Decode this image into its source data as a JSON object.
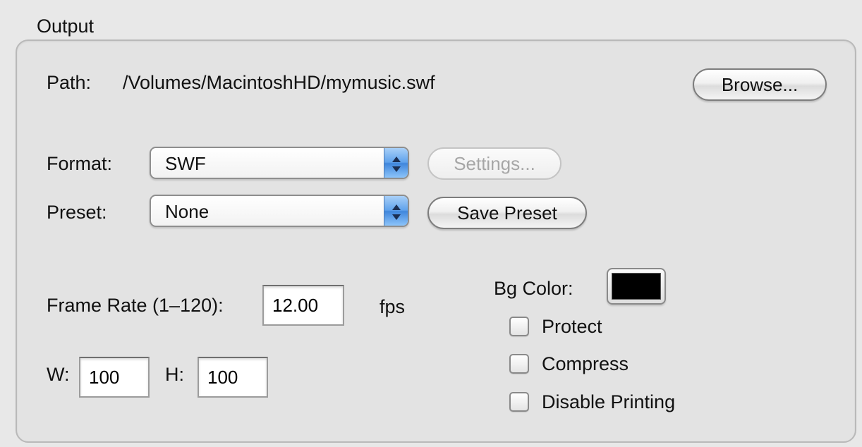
{
  "group": {
    "title": "Output"
  },
  "path": {
    "label": "Path:",
    "value": "/Volumes/MacintoshHD/mymusic.swf",
    "browse_label": "Browse..."
  },
  "format": {
    "label": "Format:",
    "selected": "SWF",
    "settings_label": "Settings...",
    "settings_enabled": false
  },
  "preset": {
    "label": "Preset:",
    "selected": "None",
    "save_label": "Save Preset"
  },
  "frame_rate": {
    "label": "Frame Rate (1–120):",
    "value": "12.00",
    "unit": "fps"
  },
  "size": {
    "w_label": "W:",
    "w_value": "100",
    "h_label": "H:",
    "h_value": "100"
  },
  "bg_color": {
    "label": "Bg Color:",
    "color": "#000000"
  },
  "options": [
    {
      "label": "Protect",
      "checked": false
    },
    {
      "label": "Compress",
      "checked": false
    },
    {
      "label": "Disable Printing",
      "checked": false
    }
  ],
  "icons": {
    "popup_arrows": "up-down-arrows-icon"
  },
  "colors": {
    "accent_blue": "#4a90e2",
    "window_bg": "#e8e8e8"
  }
}
